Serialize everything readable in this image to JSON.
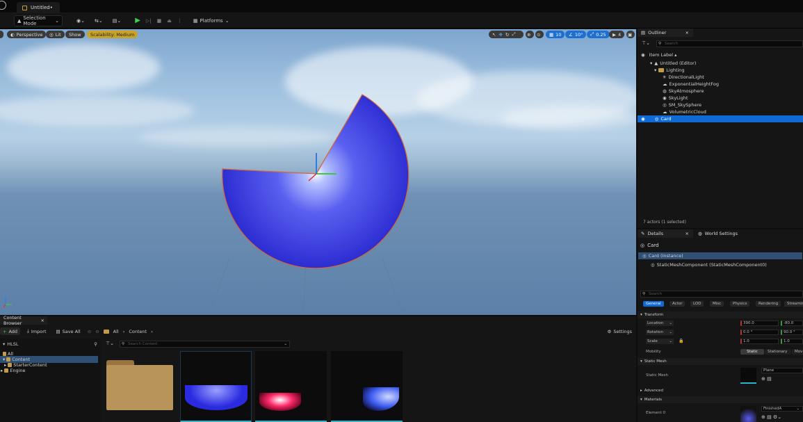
{
  "window": {
    "tab_title": "Untitled•"
  },
  "toolbar": {
    "selection_mode": "Selection Mode",
    "platforms": "Platforms"
  },
  "viewport": {
    "perspective": "Perspective",
    "lit": "Lit",
    "show": "Show",
    "scalability": "Scalability: Medium",
    "grid_snap": "10",
    "rotation_snap": "10°",
    "scale_snap": "0.25",
    "camera_speed": "4"
  },
  "outliner": {
    "title": "Outliner",
    "search_placeholder": "Search",
    "column_label": "Item Label ▴",
    "items": [
      {
        "label": "Untitled (Editor)"
      },
      {
        "label": "Lighting"
      },
      {
        "label": "DirectionalLight"
      },
      {
        "label": "ExponentialHeightFog"
      },
      {
        "label": "SkyAtmosphere"
      },
      {
        "label": "SkyLight"
      },
      {
        "label": "SM_SkySphere"
      },
      {
        "label": "VolumetricCloud"
      },
      {
        "label": "Card"
      }
    ],
    "status": "7 actors (1 selected)"
  },
  "details": {
    "tab": "Details",
    "world_settings": "World Settings",
    "object_name": "Card",
    "instance": "Card (Instance)",
    "component": "StaticMeshComponent (StaticMeshComponent0)",
    "search_placeholder": "Search",
    "categories": [
      "General",
      "Actor",
      "LOD",
      "Misc",
      "Physics",
      "Rendering",
      "Streamin"
    ],
    "transform_header": "Transform",
    "location_label": "Location",
    "location_x": "390.0",
    "location_y": "-80.0",
    "rotation_label": "Rotation",
    "rotation_x": "0.0 °",
    "rotation_y": "90.0 °",
    "scale_label": "Scale",
    "scale_x": "1.0",
    "scale_y": "1.0",
    "mobility_label": "Mobility",
    "mobility_static": "Static",
    "mobility_stationary": "Stationary",
    "mobility_movable": "Mov",
    "static_mesh_header": "Static Mesh",
    "static_mesh_label": "Static Mesh",
    "static_mesh_value": "Plane",
    "advanced_header": "Advanced",
    "materials_header": "Materials",
    "element0_label": "Element 0",
    "element0_value": "FinishedA"
  },
  "content_browser": {
    "title": "Content Browser",
    "add": "Add",
    "import": "Import",
    "save_all": "Save All",
    "breadcrumb_all": "All",
    "breadcrumb_content": "Content",
    "settings": "Settings",
    "search_placeholder": "Search Content",
    "project": "HLSL",
    "tree": [
      {
        "label": "All"
      },
      {
        "label": "Content"
      },
      {
        "label": "StarterContent"
      },
      {
        "label": "Engine"
      }
    ]
  },
  "colors": {
    "selection": "#0f6ad6",
    "accent_yellow": "#c9a227",
    "mesh_blue": "#3a3ae0"
  }
}
